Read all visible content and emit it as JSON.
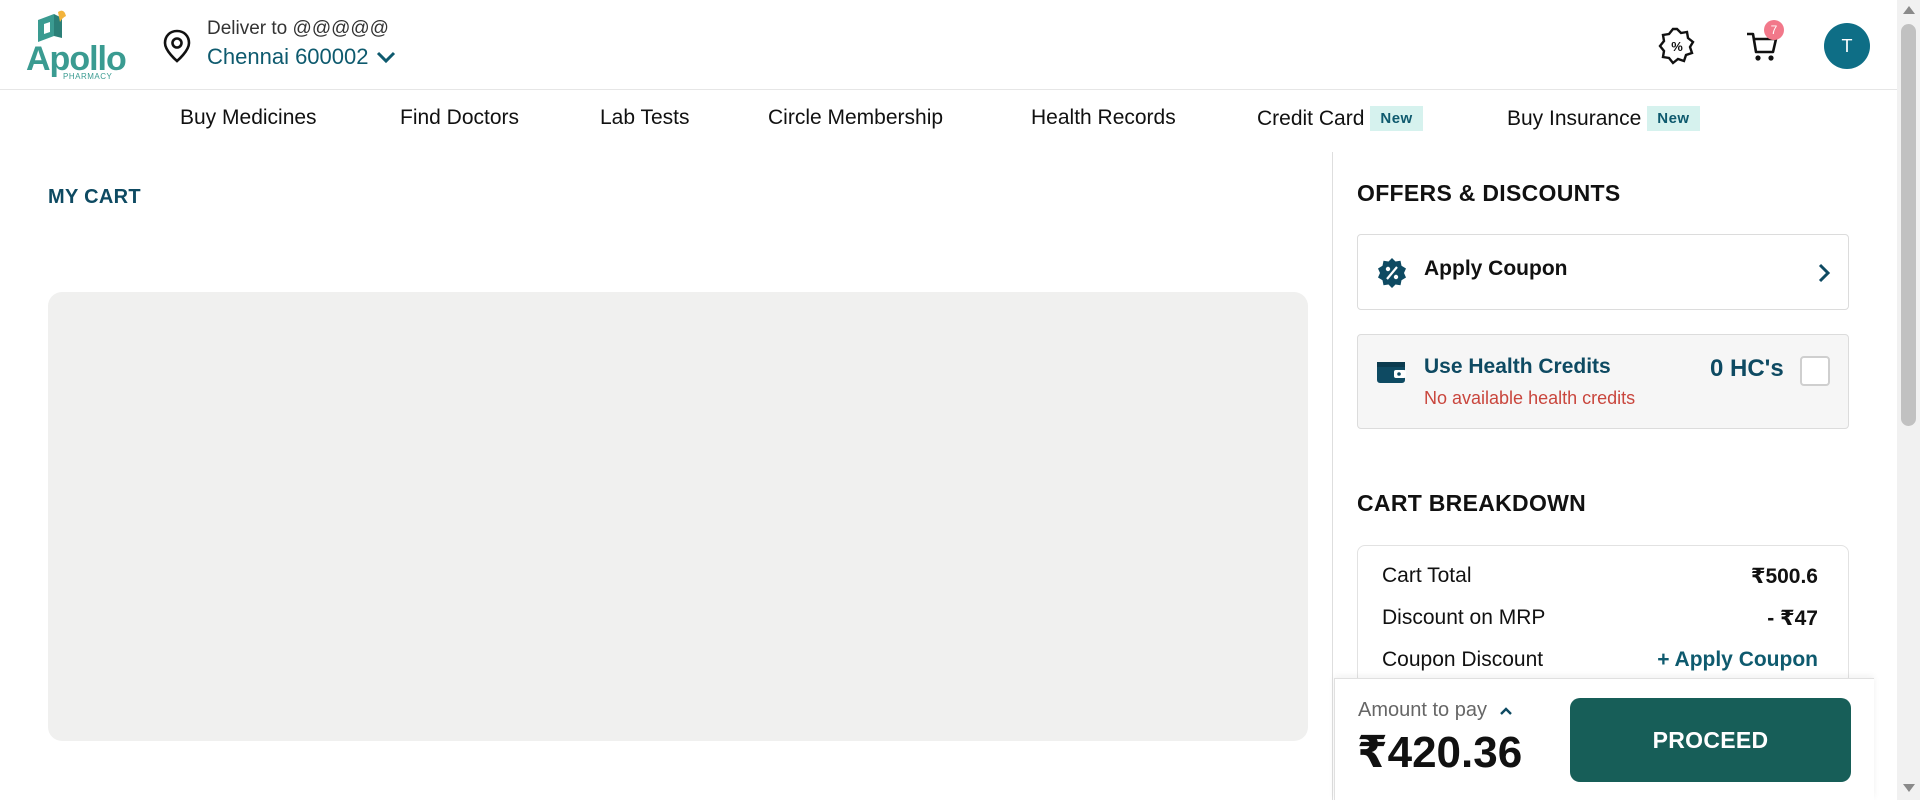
{
  "header": {
    "logo_text": "Apollo",
    "logo_sub": "PHARMACY",
    "deliver_label": "Deliver to @@@@@",
    "deliver_city": "Chennai 600002",
    "cart_count": "7",
    "avatar_initial": "T"
  },
  "nav": {
    "items": [
      {
        "label": "Buy Medicines"
      },
      {
        "label": "Find Doctors"
      },
      {
        "label": "Lab Tests"
      },
      {
        "label": "Circle Membership"
      },
      {
        "label": "Health Records"
      },
      {
        "label": "Credit Card",
        "tag": "New"
      },
      {
        "label": "Buy Insurance",
        "tag": "New"
      }
    ]
  },
  "main": {
    "title": "MY CART"
  },
  "offers": {
    "title": "OFFERS & DISCOUNTS",
    "coupon_label": "Apply Coupon",
    "health_credits_title": "Use Health Credits",
    "health_credits_sub": "No available health credits",
    "health_credits_amount": "0 HC's"
  },
  "breakdown": {
    "title": "CART BREAKDOWN",
    "rows": [
      {
        "label": "Cart Total",
        "value": "₹500.6"
      },
      {
        "label": "Discount on MRP",
        "value": "- ₹47"
      },
      {
        "label": "Coupon Discount",
        "value": "+ Apply Coupon"
      }
    ]
  },
  "pay": {
    "label": "Amount to pay",
    "amount": "₹420.36",
    "proceed_label": "PROCEED"
  },
  "colors": {
    "brand_teal": "#3a9b91",
    "primary_dark": "#0e4a62",
    "proceed_bg": "#175e58",
    "badge": "#f2788a",
    "error": "#c9463d"
  }
}
